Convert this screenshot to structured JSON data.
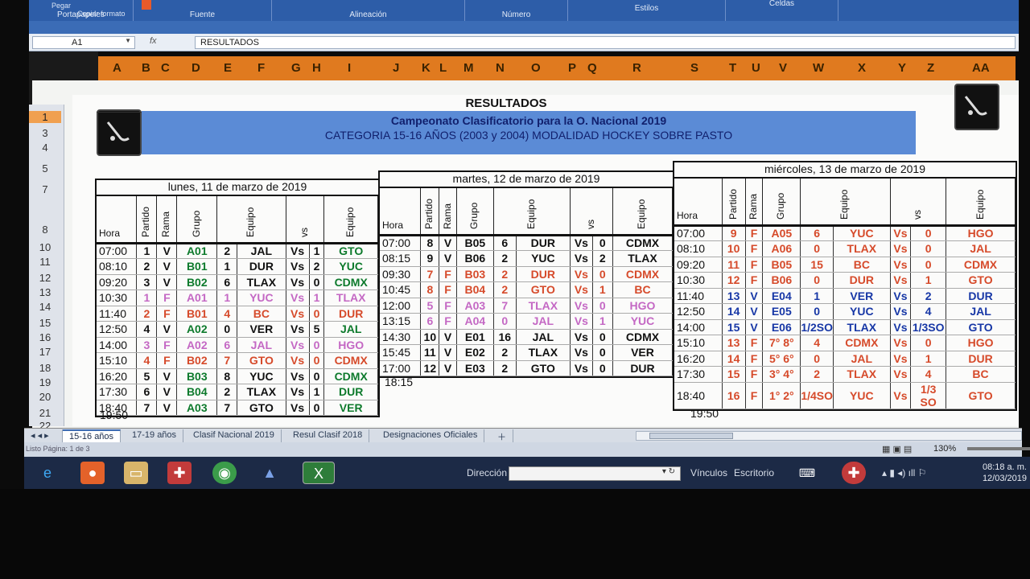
{
  "ribbon": {
    "groups": [
      "Portapapeles",
      "Fuente",
      "Alineación",
      "Número",
      "Estilos",
      "Celdas"
    ],
    "small_items": [
      "Pegar",
      "Copiar formato"
    ]
  },
  "formula_bar": {
    "name_box": "A1",
    "fx": "fx",
    "value": "RESULTADOS"
  },
  "columns": [
    "A",
    "B",
    "C",
    "D",
    "E",
    "F",
    "G",
    "H",
    "I",
    "J",
    "K",
    "L",
    "M",
    "N",
    "O",
    "P",
    "Q",
    "R",
    "S",
    "T",
    "U",
    "V",
    "W",
    "X",
    "Y",
    "Z",
    "AA"
  ],
  "rows": [
    "1",
    "3",
    "4",
    "5",
    "7",
    "8",
    "10",
    "11",
    "12",
    "13",
    "14",
    "15",
    "16",
    "17",
    "18",
    "19",
    "20",
    "21",
    "22"
  ],
  "sheet": {
    "title": "RESULTADOS",
    "banner_line1": "Campeonato Clasificatorio para la O. Nacional 2019",
    "banner_line2": "CATEGORIA 15-16 AÑOS (2003 y 2004) MODALIDAD HOCKEY SOBRE PASTO",
    "headers": {
      "hora": "Hora",
      "partido": "Partido",
      "rama": "Rama",
      "grupo": "Grupo",
      "equipo": "Equipo",
      "vs": "vs"
    },
    "day1": {
      "title": "lunes, 11 de marzo de 2019",
      "rows": [
        {
          "hora": "07:00",
          "partido": "1",
          "rama": "V",
          "grupo": "A01",
          "g1": "2",
          "eq1": "JAL",
          "vs": "Vs",
          "g2": "1",
          "eq2": "GTO"
        },
        {
          "hora": "08:10",
          "partido": "2",
          "rama": "V",
          "grupo": "B01",
          "g1": "1",
          "eq1": "DUR",
          "vs": "Vs",
          "g2": "2",
          "eq2": "YUC"
        },
        {
          "hora": "09:20",
          "partido": "3",
          "rama": "V",
          "grupo": "B02",
          "g1": "6",
          "eq1": "TLAX",
          "vs": "Vs",
          "g2": "0",
          "eq2": "CDMX"
        },
        {
          "hora": "10:30",
          "partido": "1",
          "rama": "F",
          "grupo": "A01",
          "g1": "1",
          "eq1": "YUC",
          "vs": "Vs",
          "g2": "1",
          "eq2": "TLAX"
        },
        {
          "hora": "11:40",
          "partido": "2",
          "rama": "F",
          "grupo": "B01",
          "g1": "4",
          "eq1": "BC",
          "vs": "Vs",
          "g2": "0",
          "eq2": "DUR"
        },
        {
          "hora": "12:50",
          "partido": "4",
          "rama": "V",
          "grupo": "A02",
          "g1": "0",
          "eq1": "VER",
          "vs": "Vs",
          "g2": "5",
          "eq2": "JAL"
        },
        {
          "hora": "14:00",
          "partido": "3",
          "rama": "F",
          "grupo": "A02",
          "g1": "6",
          "eq1": "JAL",
          "vs": "Vs",
          "g2": "0",
          "eq2": "HGO"
        },
        {
          "hora": "15:10",
          "partido": "4",
          "rama": "F",
          "grupo": "B02",
          "g1": "7",
          "eq1": "GTO",
          "vs": "Vs",
          "g2": "0",
          "eq2": "CDMX"
        },
        {
          "hora": "16:20",
          "partido": "5",
          "rama": "V",
          "grupo": "B03",
          "g1": "8",
          "eq1": "YUC",
          "vs": "Vs",
          "g2": "0",
          "eq2": "CDMX"
        },
        {
          "hora": "17:30",
          "partido": "6",
          "rama": "V",
          "grupo": "B04",
          "g1": "2",
          "eq1": "TLAX",
          "vs": "Vs",
          "g2": "1",
          "eq2": "DUR"
        },
        {
          "hora": "18:40",
          "partido": "7",
          "rama": "V",
          "grupo": "A03",
          "g1": "7",
          "eq1": "GTO",
          "vs": "Vs",
          "g2": "0",
          "eq2": "VER"
        }
      ],
      "after": "19:50"
    },
    "day2": {
      "title": "martes, 12 de marzo de 2019",
      "rows": [
        {
          "hora": "07:00",
          "partido": "8",
          "rama": "V",
          "grupo": "B05",
          "g1": "6",
          "eq1": "DUR",
          "vs": "Vs",
          "g2": "0",
          "eq2": "CDMX"
        },
        {
          "hora": "08:15",
          "partido": "9",
          "rama": "V",
          "grupo": "B06",
          "g1": "2",
          "eq1": "YUC",
          "vs": "Vs",
          "g2": "2",
          "eq2": "TLAX"
        },
        {
          "hora": "09:30",
          "partido": "7",
          "rama": "F",
          "grupo": "B03",
          "g1": "2",
          "eq1": "DUR",
          "vs": "Vs",
          "g2": "0",
          "eq2": "CDMX"
        },
        {
          "hora": "10:45",
          "partido": "8",
          "rama": "F",
          "grupo": "B04",
          "g1": "2",
          "eq1": "GTO",
          "vs": "Vs",
          "g2": "1",
          "eq2": "BC"
        },
        {
          "hora": "12:00",
          "partido": "5",
          "rama": "F",
          "grupo": "A03",
          "g1": "7",
          "eq1": "TLAX",
          "vs": "Vs",
          "g2": "0",
          "eq2": "HGO"
        },
        {
          "hora": "13:15",
          "partido": "6",
          "rama": "F",
          "grupo": "A04",
          "g1": "0",
          "eq1": "JAL",
          "vs": "Vs",
          "g2": "1",
          "eq2": "YUC"
        },
        {
          "hora": "14:30",
          "partido": "10",
          "rama": "V",
          "grupo": "E01",
          "g1": "16",
          "eq1": "JAL",
          "vs": "Vs",
          "g2": "0",
          "eq2": "CDMX"
        },
        {
          "hora": "15:45",
          "partido": "11",
          "rama": "V",
          "grupo": "E02",
          "g1": "2",
          "eq1": "TLAX",
          "vs": "Vs",
          "g2": "0",
          "eq2": "VER"
        },
        {
          "hora": "17:00",
          "partido": "12",
          "rama": "V",
          "grupo": "E03",
          "g1": "2",
          "eq1": "GTO",
          "vs": "Vs",
          "g2": "0",
          "eq2": "DUR"
        }
      ],
      "after": "18:15"
    },
    "day3": {
      "title": "miércoles, 13 de marzo de 2019",
      "rows": [
        {
          "hora": "07:00",
          "partido": "9",
          "rama": "F",
          "grupo": "A05",
          "g1": "6",
          "eq1": "YUC",
          "vs": "Vs",
          "g2": "0",
          "eq2": "HGO"
        },
        {
          "hora": "08:10",
          "partido": "10",
          "rama": "F",
          "grupo": "A06",
          "g1": "0",
          "eq1": "TLAX",
          "vs": "Vs",
          "g2": "0",
          "eq2": "JAL"
        },
        {
          "hora": "09:20",
          "partido": "11",
          "rama": "F",
          "grupo": "B05",
          "g1": "15",
          "eq1": "BC",
          "vs": "Vs",
          "g2": "0",
          "eq2": "CDMX"
        },
        {
          "hora": "10:30",
          "partido": "12",
          "rama": "F",
          "grupo": "B06",
          "g1": "0",
          "eq1": "DUR",
          "vs": "Vs",
          "g2": "1",
          "eq2": "GTO"
        },
        {
          "hora": "11:40",
          "partido": "13",
          "rama": "V",
          "grupo": "E04",
          "g1": "1",
          "eq1": "VER",
          "vs": "Vs",
          "g2": "2",
          "eq2": "DUR"
        },
        {
          "hora": "12:50",
          "partido": "14",
          "rama": "V",
          "grupo": "E05",
          "g1": "0",
          "eq1": "YUC",
          "vs": "Vs",
          "g2": "4",
          "eq2": "JAL"
        },
        {
          "hora": "14:00",
          "partido": "15",
          "rama": "V",
          "grupo": "E06",
          "g1": "1/2SO",
          "eq1": "TLAX",
          "vs": "Vs",
          "g2": "1/3SO",
          "eq2": "GTO"
        },
        {
          "hora": "15:10",
          "partido": "13",
          "rama": "F",
          "grupo": "7° 8°",
          "g1": "4",
          "eq1": "CDMX",
          "vs": "Vs",
          "g2": "0",
          "eq2": "HGO"
        },
        {
          "hora": "16:20",
          "partido": "14",
          "rama": "F",
          "grupo": "5° 6°",
          "g1": "0",
          "eq1": "JAL",
          "vs": "Vs",
          "g2": "1",
          "eq2": "DUR"
        },
        {
          "hora": "17:30",
          "partido": "15",
          "rama": "F",
          "grupo": "3° 4°",
          "g1": "2",
          "eq1": "TLAX",
          "vs": "Vs",
          "g2": "4",
          "eq2": "BC"
        },
        {
          "hora": "18:40",
          "partido": "16",
          "rama": "F",
          "grupo": "1° 2°",
          "g1": "1/4SO",
          "eq1": "YUC",
          "vs": "Vs",
          "g2": "1/3 SO",
          "eq2": "GTO"
        }
      ],
      "after": "19:50"
    }
  },
  "tabs": [
    "15-16 años",
    "17-19 años",
    "Clasif Nacional 2019",
    "Resul Clasif 2018",
    "Designaciones Oficiales"
  ],
  "status": {
    "left": "Listo   Página: 1 de 3",
    "zoom": "130%"
  },
  "taskbar": {
    "address_label": "Dirección",
    "links": "Vínculos",
    "desktop": "Escritorio",
    "time": "08:18 a. m.",
    "date": "12/03/2019"
  },
  "colors": {
    "ribbon": "#2d5da8",
    "col_header": "#e07a1f",
    "banner": "#5b8bd6",
    "female": "#d64a2a",
    "female_alt": "#c468c4",
    "male_green": "#0d7a2c",
    "male_blue": "#1737a6"
  }
}
